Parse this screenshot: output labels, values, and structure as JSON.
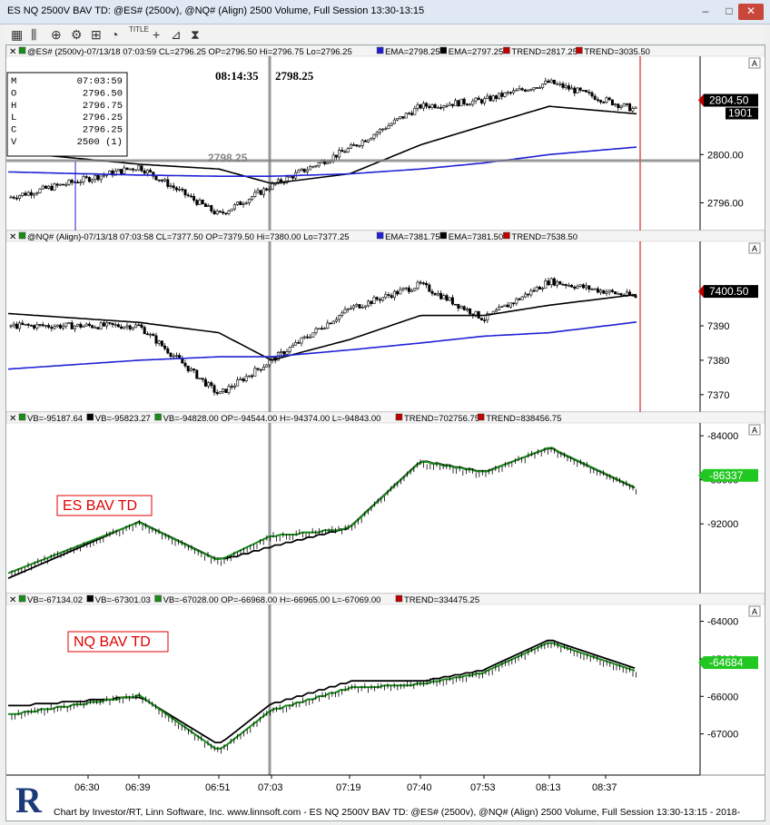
{
  "window": {
    "title": "ES NQ 2500V BAV TD: @ES# (2500v), @NQ# (Align) 2500 Volume, Full Session 13:30-13:15",
    "minimize": "–",
    "maximize": "□",
    "close": "✕"
  },
  "toolbar": {
    "tools": [
      {
        "icon": "bar-chart-icon",
        "glyph": "▦"
      },
      {
        "icon": "candlestick-icon",
        "glyph": "⫼"
      },
      {
        "icon": "zoom-icon",
        "glyph": "⊕"
      },
      {
        "icon": "settings-gear-icon",
        "glyph": "⚙"
      },
      {
        "icon": "ruler-icon",
        "glyph": "⊞"
      },
      {
        "icon": "clock-icon",
        "glyph": "◔"
      },
      {
        "icon": "title-icon",
        "glyph": "TITLE"
      },
      {
        "icon": "crosshair-icon",
        "glyph": "+"
      },
      {
        "icon": "compare-icon",
        "glyph": "⊿"
      },
      {
        "icon": "hourglass-icon",
        "glyph": "⧗"
      }
    ]
  },
  "colors": {
    "up": "#000000",
    "down": "#000000",
    "ema_fast": "#000000",
    "ema_slow": "#1f1fd6",
    "trend_red": "#c00000",
    "bav_green": "#1a8c1a",
    "crosshair": "#808080",
    "price_tag": "#000000",
    "bav_tag": "#22c822",
    "label_red": "#e00000"
  },
  "panels": [
    {
      "id": "es",
      "legend": "@ES# (2500v)-07/13/18 07:03:59 CL=2796.25 OP=2796.50 Hi=2796.75 Lo=2796.25",
      "legend_parts": [
        "EMA=2798.25",
        "EMA=2797.25",
        "TREND=2817.25",
        "TREND=3035.50"
      ],
      "price_tag": "2804.50",
      "volume_tag": "1901",
      "ticks": [
        "2800.00",
        "2796.00"
      ],
      "cursor_time": "08:14:35",
      "cursor_value": "2798.25",
      "overlay_value": "2798.25",
      "ohlc_box": {
        "rows": [
          [
            "M",
            "07:03:59"
          ],
          [
            "O",
            "2796.50"
          ],
          [
            "H",
            "2796.75"
          ],
          [
            "L",
            "2796.25"
          ],
          [
            "C",
            "2796.25"
          ],
          [
            "V",
            "2500  (1)"
          ]
        ]
      }
    },
    {
      "id": "nq",
      "legend": "@NQ# (Align)-07/13/18 07:03:58 CL=7377.50 OP=7379.50 Hi=7380.00 Lo=7377.25",
      "legend_parts": [
        "EMA=7381.75",
        "EMA=7381.50",
        "TREND=7538.50"
      ],
      "price_tag": "7400.50",
      "ticks": [
        "7390",
        "7380",
        "7370"
      ]
    },
    {
      "id": "esbav",
      "legend_parts": [
        "VB=-95187.64",
        "VB=-95823.27",
        "VB=-94828.00 OP=-94544.00 H=-94374.00 L=-94843.00",
        "TREND=702756.75",
        "TREND=838456.75"
      ],
      "bav_tag": "-86337",
      "ticks": [
        "-84000",
        "-88000",
        "-92000"
      ],
      "label": "ES BAV TD"
    },
    {
      "id": "nqbav",
      "legend_parts": [
        "VB=-67134.02",
        "VB=-67301.03",
        "VB=-67028.00 OP=-66968.00 H=-66965.00 L=-67069.00",
        "TREND=334475.25"
      ],
      "bav_tag": "-64684",
      "ticks": [
        "-64000",
        "-65000",
        "-66000",
        "-67000"
      ],
      "label": "NQ BAV TD"
    }
  ],
  "time_axis": [
    "06:30",
    "06:39",
    "06:51",
    "07:03",
    "07:19",
    "07:40",
    "07:53",
    "08:13",
    "08:37"
  ],
  "footer": "Chart by Investor/RT, Linn Software, Inc. www.linnsoft.com - ES NQ 2500V BAV TD: @ES# (2500v), @NQ# (Align) 2500 Volume, Full Session 13:30-13:15 - 2018-",
  "chart_data": [
    {
      "type": "line",
      "panel": "ES",
      "ylim": [
        2794,
        2808
      ],
      "ticks": [
        2800.0,
        2796.0
      ],
      "x": [
        "06:30",
        "06:39",
        "06:51",
        "07:03",
        "07:19",
        "07:40",
        "07:53",
        "08:13",
        "08:37"
      ],
      "series": [
        {
          "name": "EMA",
          "values": [
            2799.6,
            2799.2,
            2798.8,
            2797.6,
            2798.4,
            2800.8,
            2802.4,
            2804.0,
            2803.6
          ]
        },
        {
          "name": "EMA",
          "values": [
            2798.4,
            2798.3,
            2798.2,
            2798.2,
            2798.4,
            2798.8,
            2799.3,
            2800.0,
            2800.4
          ]
        },
        {
          "name": "close",
          "values": [
            2798.0,
            2799.0,
            2795.0,
            2797.4,
            2800.5,
            2804.0,
            2804.5,
            2806.0,
            2804.5
          ]
        }
      ]
    },
    {
      "type": "line",
      "panel": "NQ",
      "ylim": [
        7366,
        7414
      ],
      "ticks": [
        7390,
        7380,
        7370
      ],
      "x": [
        "06:30",
        "06:39",
        "06:51",
        "07:03",
        "07:19",
        "07:40",
        "07:53",
        "08:13",
        "08:37"
      ],
      "series": [
        {
          "name": "EMA",
          "values": [
            7392,
            7391,
            7388,
            7380,
            7386,
            7393,
            7393,
            7396,
            7398
          ]
        },
        {
          "name": "EMA",
          "values": [
            7379,
            7380,
            7381,
            7381,
            7383,
            7385,
            7387,
            7388,
            7390
          ]
        },
        {
          "name": "close",
          "values": [
            7390,
            7390,
            7370,
            7380,
            7395,
            7402,
            7392,
            7403,
            7400
          ]
        }
      ]
    },
    {
      "type": "line",
      "panel": "ES BAV TD",
      "ylim": [
        -98000,
        -83000
      ],
      "ticks": [
        -84000,
        -88000,
        -92000
      ],
      "x": [
        "06:30",
        "06:39",
        "06:51",
        "07:03",
        "07:19",
        "07:40",
        "07:53",
        "08:13",
        "08:37"
      ],
      "series": [
        {
          "name": "VB",
          "values": [
            -93800,
            -92000,
            -95500,
            -93200,
            -92500,
            -86500,
            -87500,
            -85200,
            -87600
          ]
        },
        {
          "name": "VB",
          "values": [
            -93500,
            -91500,
            -95000,
            -93700,
            -92000,
            -86000,
            -87000,
            -84800,
            -87200
          ]
        }
      ]
    },
    {
      "type": "line",
      "panel": "NQ BAV TD",
      "ylim": [
        -68000,
        -63600
      ],
      "ticks": [
        -64000,
        -65000,
        -66000,
        -67000
      ],
      "x": [
        "06:30",
        "06:39",
        "06:51",
        "07:03",
        "07:19",
        "07:40",
        "07:53",
        "08:13",
        "08:37"
      ],
      "series": [
        {
          "name": "VB",
          "values": [
            -66200,
            -66000,
            -67500,
            -66400,
            -65800,
            -65700,
            -65400,
            -64600,
            -65100
          ]
        },
        {
          "name": "VB",
          "values": [
            -66000,
            -65900,
            -67200,
            -66100,
            -65500,
            -65500,
            -65200,
            -64400,
            -64900
          ]
        }
      ]
    }
  ]
}
